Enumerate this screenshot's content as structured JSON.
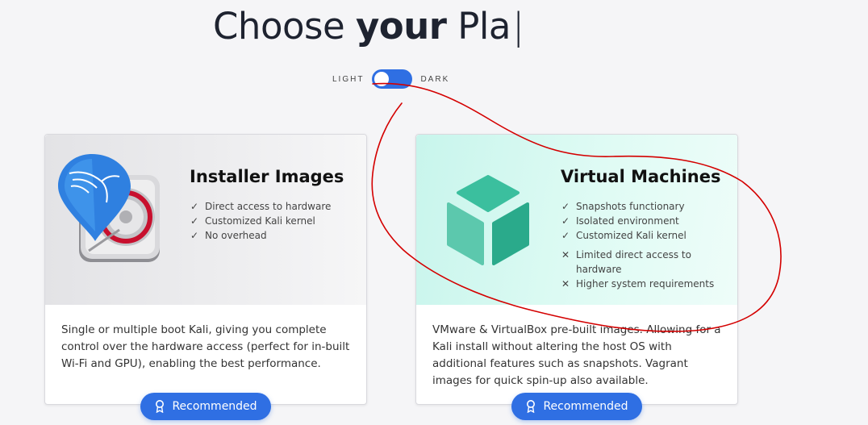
{
  "headline": {
    "prefix": "Choose",
    "bold": "your",
    "suffix": "Pla",
    "caret": "|"
  },
  "theme_toggle": {
    "left_label": "LIGHT",
    "right_label": "DARK"
  },
  "cards": [
    {
      "title": "Installer Images",
      "features": [
        {
          "mark": "✓",
          "text": "Direct access to hardware"
        },
        {
          "mark": "✓",
          "text": "Customized Kali kernel"
        },
        {
          "mark": "✓",
          "text": "No overhead"
        }
      ],
      "description": "Single or multiple boot Kali, giving you complete control over the hardware access (perfect for in-built Wi-Fi and GPU), enabling the best performance.",
      "button": "Recommended"
    },
    {
      "title": "Virtual Machines",
      "features": [
        {
          "mark": "✓",
          "text": "Snapshots functionary"
        },
        {
          "mark": "✓",
          "text": "Isolated environment"
        },
        {
          "mark": "✓",
          "text": "Customized Kali kernel"
        },
        {
          "mark": "✕",
          "text": "Limited direct access to hardware"
        },
        {
          "mark": "✕",
          "text": "Higher system requirements"
        }
      ],
      "description": "VMware & VirtualBox pre-built images. Allowing for a Kali install without altering the host OS with additional features such as snapshots. Vagrant images for quick spin-up also available.",
      "button": "Recommended"
    }
  ],
  "colors": {
    "accent": "#2f6fe3",
    "annotation": "#d40000",
    "vm_background": "#dffbf4"
  },
  "icons": [
    "kali-disk-icon",
    "virtual-cube-icon",
    "check-icon",
    "cross-icon",
    "ribbon-icon"
  ]
}
